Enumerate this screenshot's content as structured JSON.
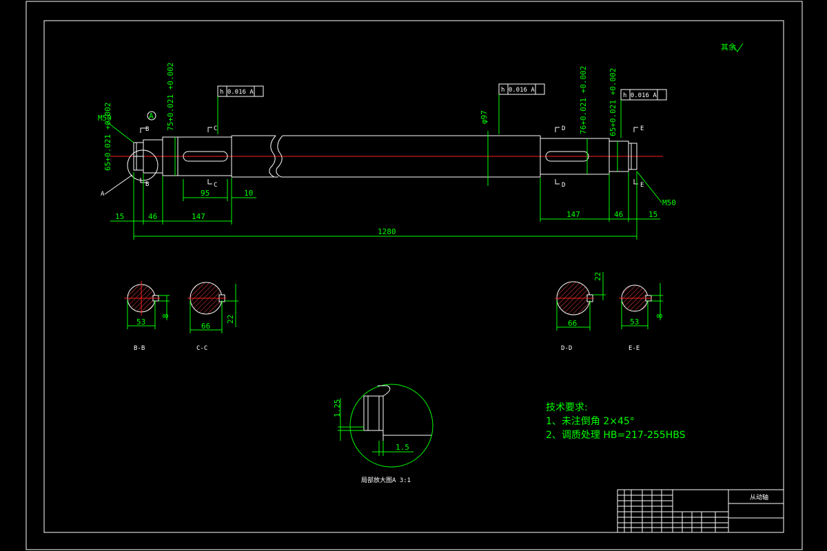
{
  "drawing": {
    "roughness_note": "其余",
    "tolerances": {
      "left": "h 0.016 A",
      "middle": "h 0.016 A",
      "right": "h 0.016 A"
    },
    "thread_left": "M50",
    "thread_right": "M50",
    "dia_left_1": "75+0.021 +0.002",
    "dia_left_2": "65+0.021 +0.002",
    "dia_mid": "φ97",
    "dia_right_1": "76+0.021 +0.002",
    "dia_right_2": "65+0.021 +0.002",
    "dims": {
      "d95": "95",
      "d10": "10",
      "d15l": "15",
      "d46l": "46",
      "d147l": "147",
      "d147r": "147",
      "d46r": "46",
      "d15r": "15",
      "overall": "1280"
    },
    "datum": "A",
    "section_letters": {
      "B": "B",
      "C": "C",
      "D": "D",
      "E": "E",
      "A": "A"
    },
    "sections": [
      {
        "label": "B-B",
        "width": "53",
        "key": "8"
      },
      {
        "label": "C-C",
        "width": "66",
        "key": "22"
      },
      {
        "label": "D-D",
        "width": "66",
        "key": "22"
      },
      {
        "label": "E-E",
        "width": "53",
        "key": "8"
      }
    ],
    "detail": {
      "dim_h": "1.25",
      "dim_w": "1.5",
      "caption": "局部放大图A  3:1"
    },
    "tech": {
      "title": "技术要求:",
      "line1": "1、未注倒角 2×45°",
      "line2": "2、调质处理 HB=217-255HBS"
    },
    "title_block": {
      "name": "从动轴"
    }
  }
}
